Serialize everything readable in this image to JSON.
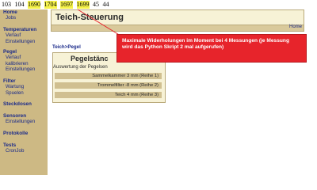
{
  "topline": [
    "103",
    "104",
    "1690",
    "1704",
    "1697",
    "1699",
    "45",
    "44"
  ],
  "sidebar": {
    "groups": [
      {
        "head": "Home",
        "links": [
          "Jobs"
        ]
      },
      {
        "head": "Temperaturen",
        "links": [
          "Verlauf",
          "Einstellungen"
        ]
      },
      {
        "head": "Pegel",
        "links": [
          "Verlauf",
          "kalibrieren",
          "Einstellungen"
        ]
      },
      {
        "head": "Filter",
        "links": [
          "Wartung",
          "Spuelen"
        ]
      },
      {
        "head": "Steckdosen",
        "links": []
      },
      {
        "head": "Sensoren",
        "links": [
          "Einstellungen"
        ]
      },
      {
        "head": "Protokolle",
        "links": []
      },
      {
        "head": "Tests",
        "links": [
          "CronJob"
        ]
      }
    ]
  },
  "header": {
    "title": "Teich-Steuerung",
    "home_link": "Home"
  },
  "breadcrumb": "Teich>Pegel",
  "panel": {
    "title": "Pegelstänc",
    "subtitle": "Auswertung der Pegelsen",
    "rows": [
      "Sammelkammer   3 mm  (Reihe 1)",
      "Trommelfilter  -8 mm  (Reihe 2)",
      "Teich   4 mm  (Reihe 3)"
    ]
  },
  "callout": {
    "text": "Maximale Widerholungen im Moment bei 4 Messungen (je Messung wird das Python Skript 2 mal aufgerufen)",
    "color": "#e7242b"
  }
}
